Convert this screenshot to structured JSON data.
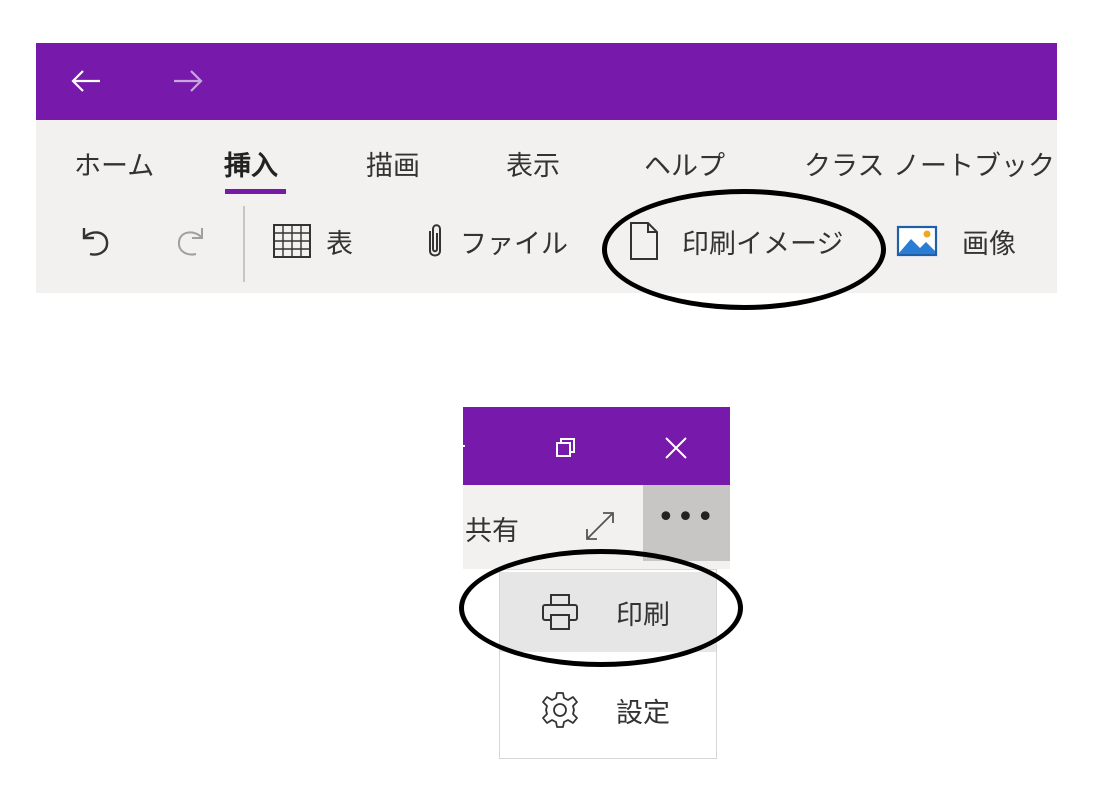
{
  "ribbon": {
    "nav": {
      "back_icon": "arrow-left-icon",
      "forward_icon": "arrow-right-icon"
    },
    "tabs": [
      {
        "label": "ホーム",
        "active": false
      },
      {
        "label": "挿入",
        "active": true
      },
      {
        "label": "描画",
        "active": false
      },
      {
        "label": "表示",
        "active": false
      },
      {
        "label": "ヘルプ",
        "active": false
      },
      {
        "label": "クラス ノートブック",
        "active": false
      }
    ],
    "tools": {
      "undo_icon": "undo-icon",
      "redo_icon": "redo-icon",
      "table_label": "表",
      "file_label": "ファイル",
      "printout_label": "印刷イメージ",
      "picture_label": "画像"
    }
  },
  "window": {
    "share_label": "共有",
    "more_label": "•••",
    "menu": {
      "print_label": "印刷",
      "settings_label": "設定"
    }
  },
  "colors": {
    "accent": "#7719aa",
    "ribbon_bg": "#f2f1f0",
    "annotation": "#000000"
  }
}
